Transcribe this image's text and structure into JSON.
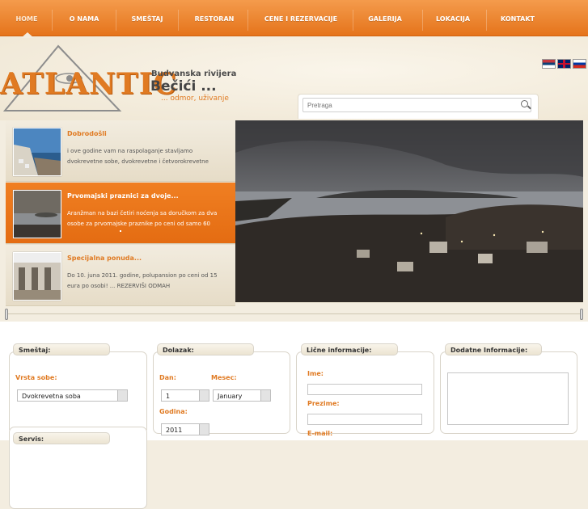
{
  "nav": {
    "items": [
      "HOME",
      "O NAMA",
      "SMEŠTAJ",
      "RESTORAN",
      "CENE I REZERVACIJE",
      "GALERIJA",
      "LOKACIJA",
      "KONTAKT"
    ]
  },
  "header": {
    "logo_text": "ATLANTIC",
    "tagline_region": "Budvanska rivijera",
    "tagline_place": "Bečići ...",
    "tagline_slogan": "... odmor, uživanje",
    "languages": [
      "sr",
      "en",
      "ru"
    ]
  },
  "search": {
    "placeholder": "Pretraga",
    "icon": "zoom-in-icon"
  },
  "slider": {
    "items": [
      {
        "title": "Dobrodošli",
        "text": "i ove godine vam na raspolaganje stavljamo dvokrevetne sobe, dvokrevetne i četvorokrevetne"
      },
      {
        "title": "Prvomajski praznici za dvoje...",
        "text": "Aranžman na bazi četiri noćenja sa doručkom za dva osobe za prvomajske praznike po ceni od samo 60"
      },
      {
        "title": "Specijalna ponuda...",
        "text": "Do 10. juna 2011. godine, polupansion po ceni od 15 eura po osobi! ... REZERVIŠI ODMAH"
      }
    ],
    "active_index": 1
  },
  "form": {
    "smestaj": {
      "tab": "Smeštaj:",
      "room_type_label": "Vrsta sobe:",
      "room_type_value": "Dvokrevetna soba"
    },
    "servis": {
      "tab": "Servis:"
    },
    "dolazak": {
      "tab": "Dolazak:",
      "day_label": "Dan:",
      "day_value": "1",
      "month_label": "Mesec:",
      "month_value": "January",
      "year_label": "Godina:",
      "year_value": "2011"
    },
    "licne": {
      "tab": "Lične informacije:",
      "name_label": "Ime:",
      "surname_label": "Prezime:",
      "email_label": "E-mail:"
    },
    "dodatne": {
      "tab": "Dodatne Informacije:"
    }
  },
  "colors": {
    "accent": "#e5741b",
    "nav_top": "#f49b4c",
    "background": "#f3ede0"
  }
}
